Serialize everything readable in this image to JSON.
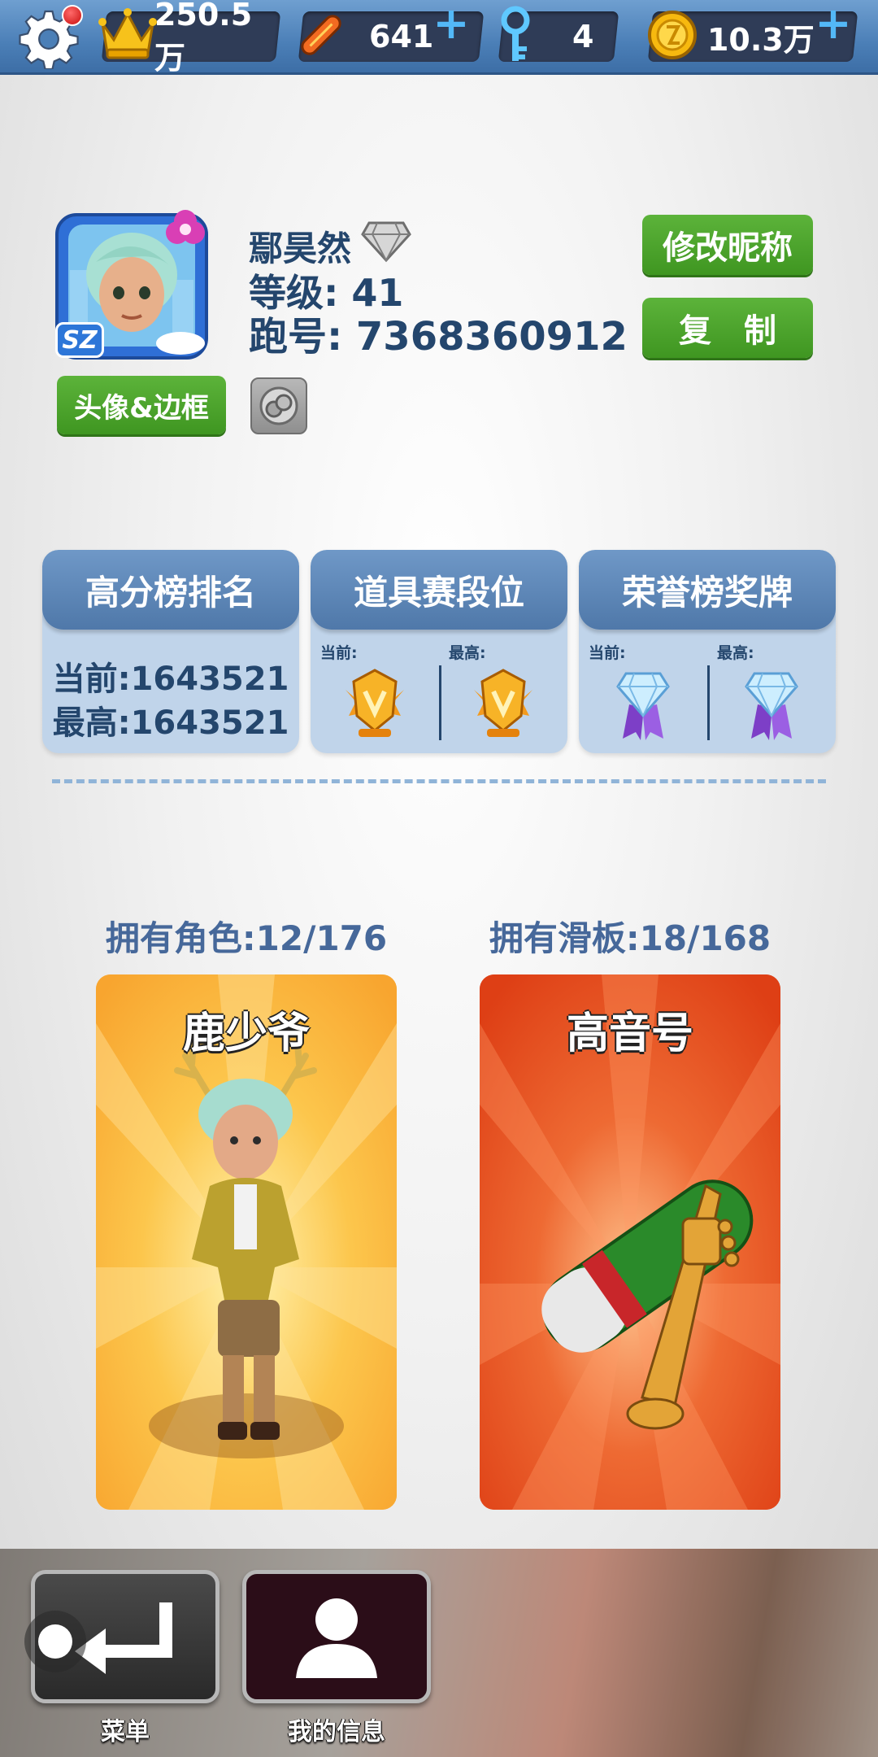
{
  "topbar": {
    "crown_value": "250.5万",
    "boards_value": "641",
    "keys_value": "4",
    "coins_value": "10.3万"
  },
  "profile": {
    "name": "鄢昊然",
    "level": "等级: 41",
    "run_id": "跑号: 7368360912",
    "avatar_badge": "SZ",
    "avatar_button": "头像&边框",
    "rename_button": "修改昵称",
    "copy_button": "复　制"
  },
  "cards": {
    "highscore": {
      "title": "高分榜排名",
      "current": "当前:1643521",
      "best": "最高:1643521"
    },
    "powerup": {
      "title": "道具赛段位",
      "current_label": "当前:",
      "best_label": "最高:"
    },
    "honor": {
      "title": "荣誉榜奖牌",
      "current_label": "当前:",
      "best_label": "最高:"
    }
  },
  "owned": {
    "characters_label": "拥有角色:12/176",
    "boards_label": "拥有滑板:18/168",
    "character_name": "鹿少爷",
    "board_name": "高音号"
  },
  "nav": {
    "menu_label": "菜单",
    "myinfo_label": "我的信息"
  },
  "colors": {
    "topbar": "#4b7fb7",
    "green_button": "#4aa52a",
    "card_bg": "#c0d4ea",
    "card_head": "#5d86b6",
    "character_bg": "#fbb03b",
    "board_bg": "#e1451b"
  }
}
